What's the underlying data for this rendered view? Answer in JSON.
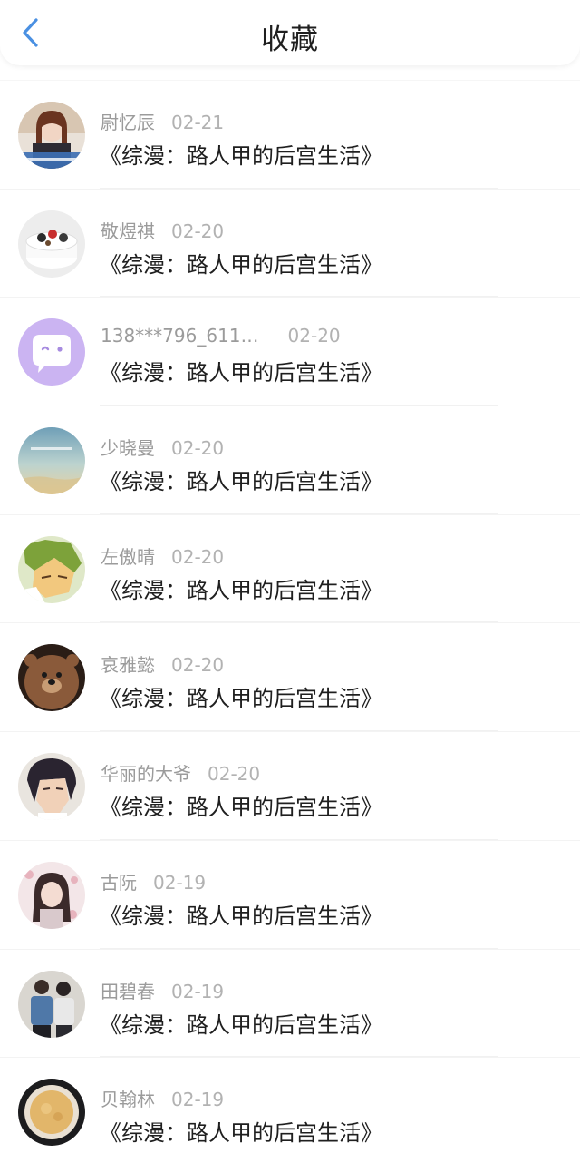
{
  "header": {
    "title": "收藏"
  },
  "items": [
    {
      "name": "尉忆辰",
      "date": "02-21",
      "title": "《综漫：路人甲的后宫生活》",
      "avatar": "photo-girl-avatar"
    },
    {
      "name": "敬煜祺",
      "date": "02-20",
      "title": "《综漫：路人甲的后宫生活》",
      "avatar": "cake-avatar"
    },
    {
      "name": "138***796_611…",
      "date": "02-20",
      "title": "《综漫：路人甲的后宫生活》",
      "avatar": "chat-bubble-avatar"
    },
    {
      "name": "少晓曼",
      "date": "02-20",
      "title": "《综漫：路人甲的后宫生活》",
      "avatar": "sky-avatar"
    },
    {
      "name": "左傲晴",
      "date": "02-20",
      "title": "《综漫：路人甲的后宫生活》",
      "avatar": "anime-boy-avatar"
    },
    {
      "name": "哀雅懿",
      "date": "02-20",
      "title": "《综漫：路人甲的后宫生活》",
      "avatar": "bear-avatar"
    },
    {
      "name": "华丽的大爷",
      "date": "02-20",
      "title": "《综漫：路人甲的后宫生活》",
      "avatar": "anime-man-avatar"
    },
    {
      "name": "古阮",
      "date": "02-19",
      "title": "《综漫：路人甲的后宫生活》",
      "avatar": "anime-girl-avatar"
    },
    {
      "name": "田碧春",
      "date": "02-19",
      "title": "《综漫：路人甲的后宫生活》",
      "avatar": "couple-avatar"
    },
    {
      "name": "贝翰林",
      "date": "02-19",
      "title": "《综漫：路人甲的后宫生活》",
      "avatar": "coffee-avatar"
    }
  ],
  "colors": {
    "accent": "#4a90e2",
    "title_text": "#1f1f1f",
    "meta_text": "#9b9b9b"
  }
}
